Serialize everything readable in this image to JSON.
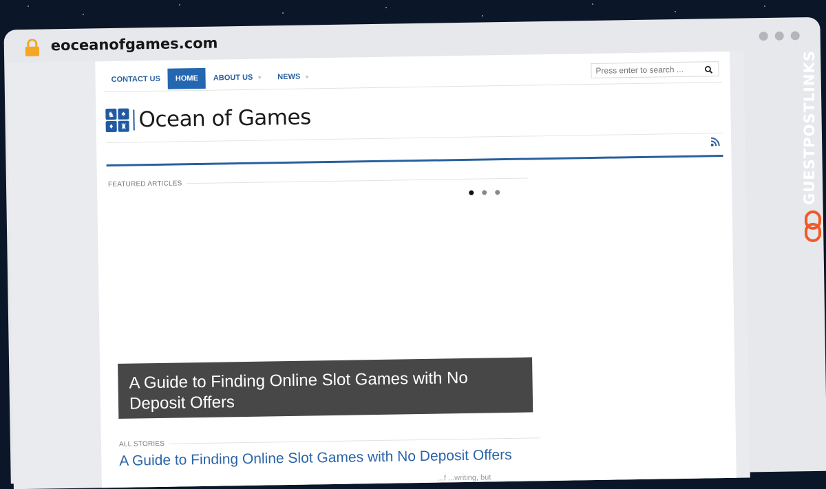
{
  "browser": {
    "url": "eoceanofgames.com",
    "lock_icon": "lock-icon"
  },
  "nav": {
    "items": [
      {
        "label": "CONTACT US",
        "active": false,
        "has_dropdown": false
      },
      {
        "label": "HOME",
        "active": true,
        "has_dropdown": false
      },
      {
        "label": "ABOUT US",
        "active": false,
        "has_dropdown": true
      },
      {
        "label": "NEWS",
        "active": false,
        "has_dropdown": true
      }
    ]
  },
  "search": {
    "placeholder": "Press enter to search ...",
    "icon": "search-icon"
  },
  "logo": {
    "text": "Ocean of Games"
  },
  "featured": {
    "label": "FEATURED ARTICLES",
    "slide_count": 3,
    "active_slide": 1,
    "caption": "A Guide to Finding Online Slot Games with No Deposit Offers"
  },
  "stories": {
    "label": "ALL STORIES",
    "items": [
      {
        "title": "A Guide to Finding Online Slot Games with No Deposit Offers",
        "excerpt_fragment": "...f ...writing, but"
      }
    ]
  },
  "watermark": {
    "text": "GUESTPOSTLINKS"
  },
  "colors": {
    "accent": "#2566b0",
    "link": "#2a64a8",
    "caption_bg": "#474747",
    "lock": "#f5a623",
    "watermark_icon": "#f05a28"
  }
}
